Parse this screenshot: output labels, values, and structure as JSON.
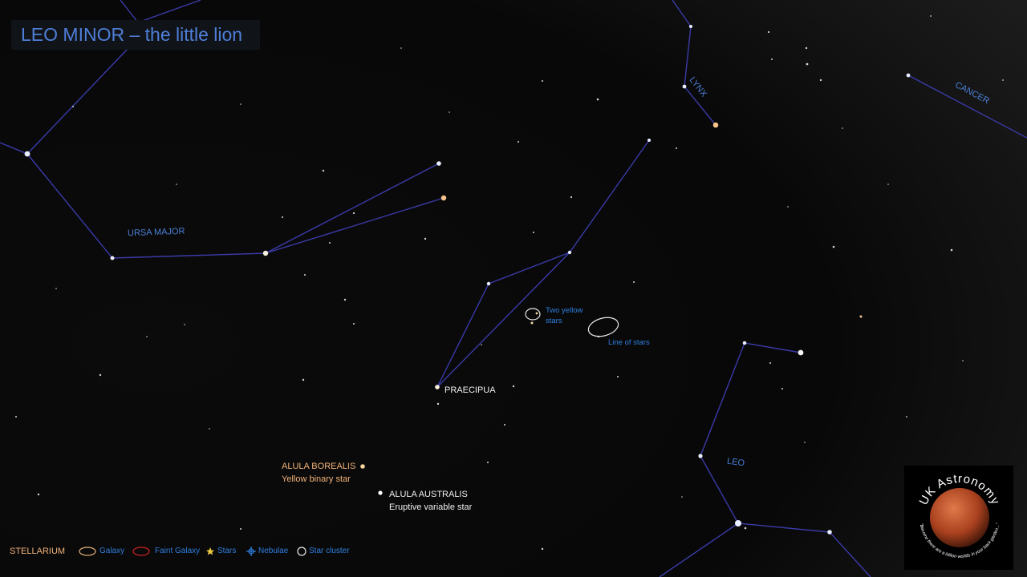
{
  "title": "LEO MINOR – the little lion",
  "constellations": {
    "ursa_major": "URSA MAJOR",
    "lynx": "LYNX",
    "cancer": "CANCER",
    "leo": "LEO"
  },
  "stars": {
    "praecipua": "PRAECIPUA",
    "alula_borealis": {
      "name": "ALULA  BOREALIS",
      "desc": "Yellow binary star"
    },
    "alula_australis": {
      "name": "ALULA  AUSTRALIS",
      "desc": "Eruptive variable star"
    }
  },
  "annotations": {
    "two_yellow_line1": "Two yellow",
    "two_yellow_line2": "stars",
    "line_of_stars": "Line of stars"
  },
  "legend": {
    "source": "STELLARIUM",
    "galaxy": "Galaxy",
    "faint_galaxy": "Faint Galaxy",
    "stars": "Stars",
    "nebulae": "Nebulae",
    "star_cluster": "Star cluster"
  },
  "logo": {
    "name": "UK Astronomy",
    "tagline": "\"Become there are a billion worlds in your back garden...\""
  },
  "colors": {
    "background": "#000000",
    "constellation_line": "#3a3aa8",
    "label_blue": "#4a7fd6",
    "label_orange": "#f2b27a"
  }
}
